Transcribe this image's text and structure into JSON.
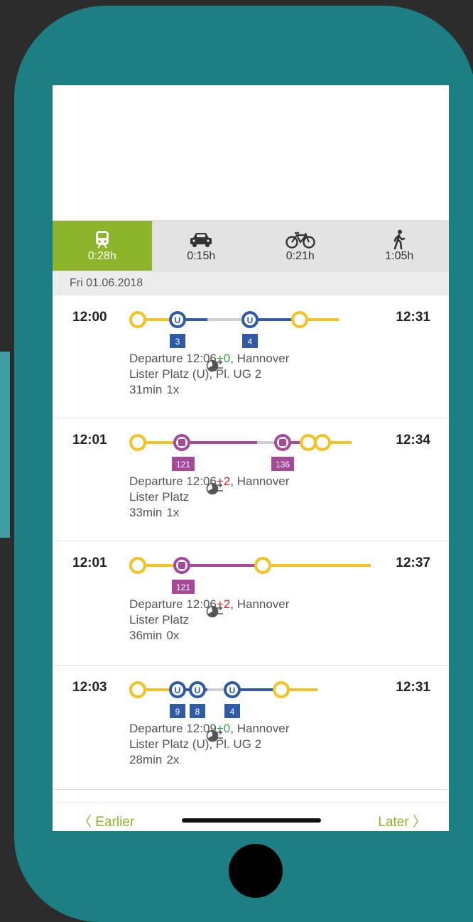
{
  "tabs": [
    {
      "mode": "train",
      "duration": "0:28h"
    },
    {
      "mode": "car",
      "duration": "0:15h"
    },
    {
      "mode": "bike",
      "duration": "0:21h"
    },
    {
      "mode": "walk",
      "duration": "1:05h"
    }
  ],
  "date": "Fri 01.06.2018",
  "trips": [
    {
      "dep": "12:00",
      "arr": "12:31",
      "lines": [
        "3",
        "4"
      ],
      "dep_label": "Departure 12:06",
      "delay": "+0",
      "place": ", Hannover",
      "stop": "Lister Platz (U), Pl. UG 2",
      "duration": "31min",
      "changes": "1x"
    },
    {
      "dep": "12:01",
      "arr": "12:34",
      "lines": [
        "121",
        "136"
      ],
      "dep_label": "Departure 12:06",
      "delay": "+2",
      "place": ", Hannover",
      "stop": "Lister Platz",
      "duration": "33min",
      "changes": "1x"
    },
    {
      "dep": "12:01",
      "arr": "12:37",
      "lines": [
        "121"
      ],
      "dep_label": "Departure 12:06",
      "delay": "+2",
      "place": ", Hannover",
      "stop": "Lister Platz",
      "duration": "36min",
      "changes": "0x"
    },
    {
      "dep": "12:03",
      "arr": "12:31",
      "lines": [
        "9",
        "8",
        "4"
      ],
      "dep_label": "Departure 12:09",
      "delay": "+0",
      "place": ", Hannover",
      "stop": "Lister Platz (U), Pl. UG 2",
      "duration": "28min",
      "changes": "2x"
    }
  ],
  "nav": {
    "earlier": "Earlier",
    "later": "Later"
  },
  "colors": {
    "accent": "#8db52b",
    "ubahn": "#2e5aa8",
    "bus": "#a6499b",
    "walk": "#f3c223",
    "phone": "#1b7f83"
  }
}
